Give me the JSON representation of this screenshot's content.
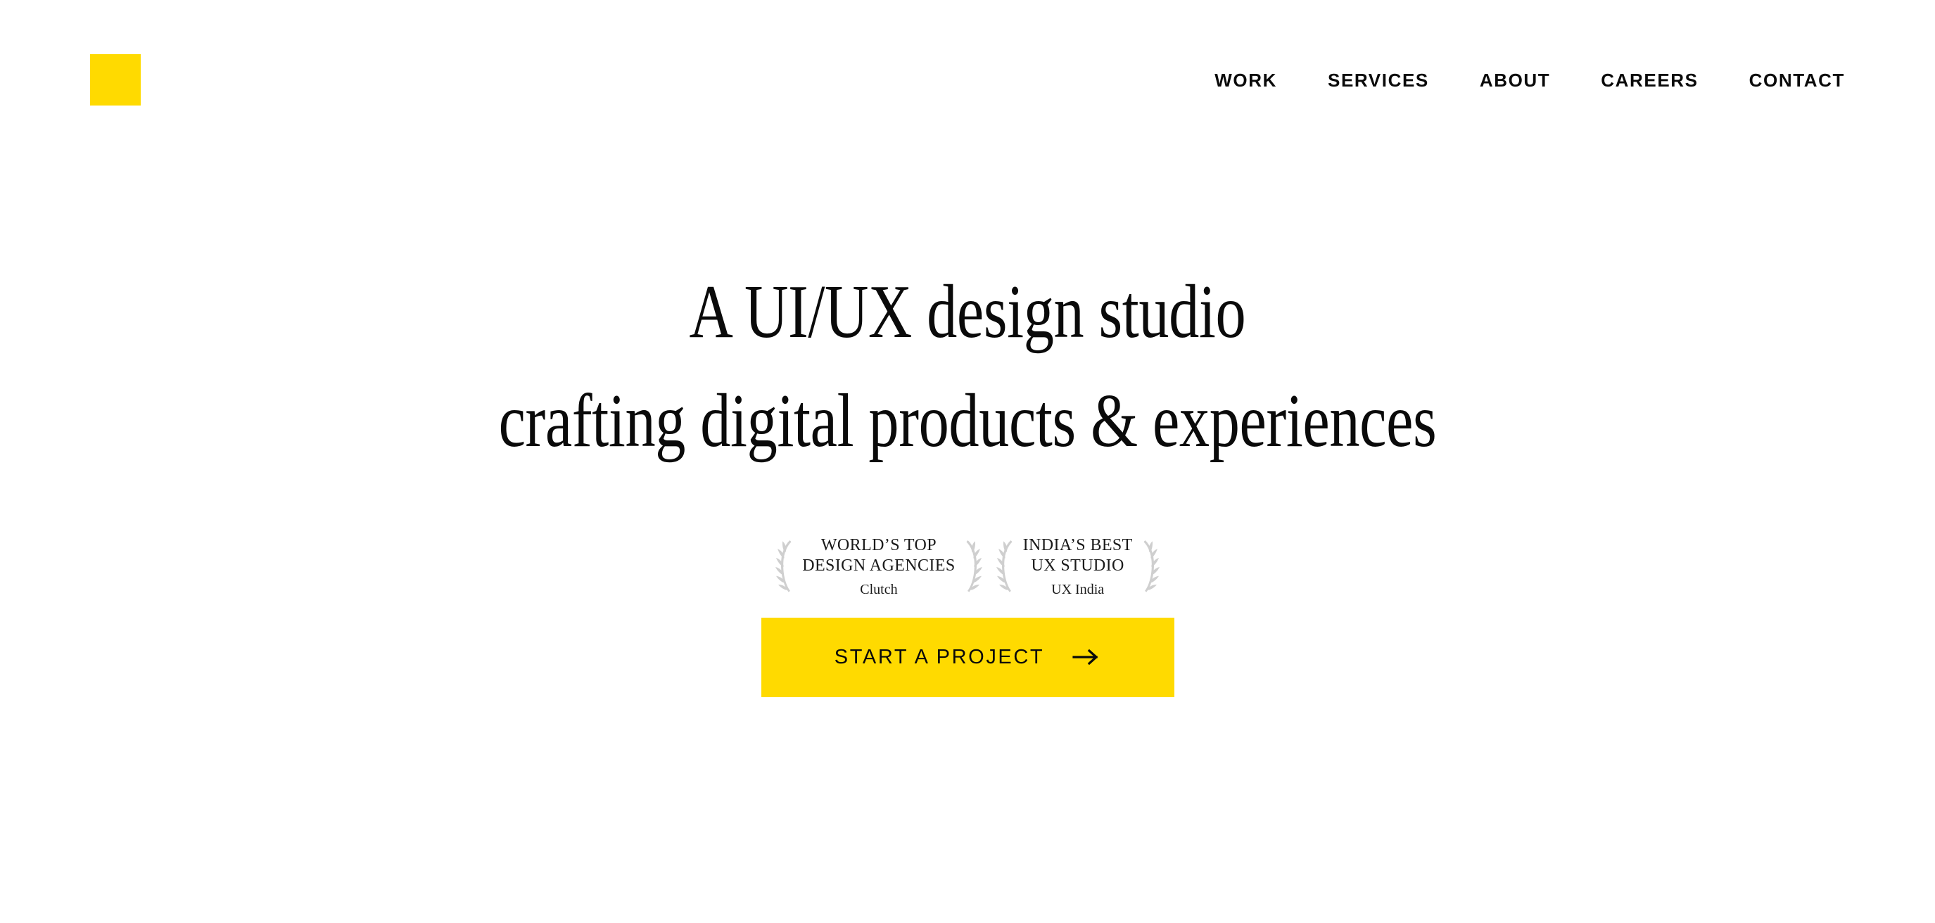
{
  "brand": {
    "logo_icon": "yellow-square-logo",
    "accent_color": "#FFDA00"
  },
  "nav": {
    "items": [
      {
        "label": "WORK"
      },
      {
        "label": "SERVICES"
      },
      {
        "label": "ABOUT"
      },
      {
        "label": "CAREERS"
      },
      {
        "label": "CONTACT"
      }
    ]
  },
  "hero": {
    "headline_line1": "A UI/UX design studio",
    "headline_line2": "crafting digital products & experiences",
    "awards": [
      {
        "line1": "WORLD’S TOP",
        "line2": "DESIGN AGENCIES",
        "source": "Clutch",
        "left_icon": "laurel-branch-icon",
        "right_icon": "laurel-branch-icon"
      },
      {
        "line1": "INDIA’S BEST",
        "line2": "UX STUDIO",
        "source": "UX India",
        "left_icon": "laurel-branch-icon",
        "right_icon": "laurel-branch-icon"
      }
    ],
    "cta": {
      "label": "START A PROJECT",
      "icon": "arrow-right-icon",
      "background": "#FFDA00",
      "text_color": "#0a0a0a"
    }
  }
}
